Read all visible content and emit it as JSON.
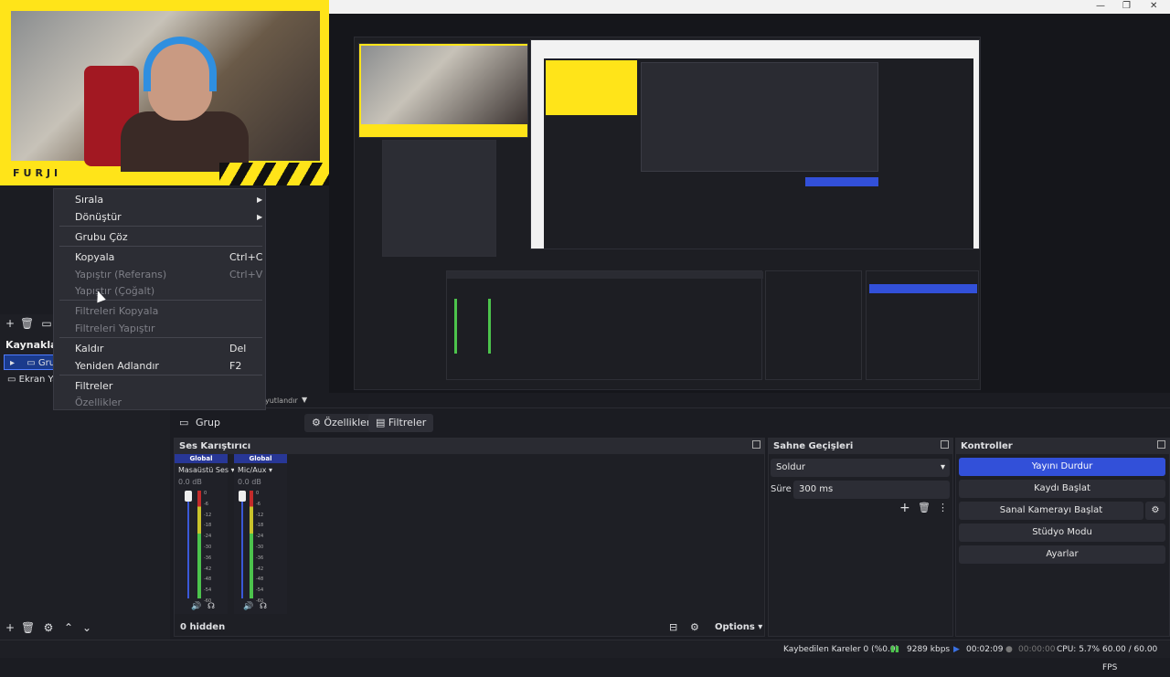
{
  "webcam": {
    "brand": "FURJI"
  },
  "context_menu": {
    "items": [
      {
        "label": "Sırala",
        "shortcut": "",
        "submenu": true,
        "disabled": false
      },
      {
        "label": "Dönüştür",
        "shortcut": "",
        "submenu": true,
        "disabled": false
      },
      {
        "label": "Grubu Çöz",
        "shortcut": "",
        "submenu": false,
        "disabled": false
      },
      {
        "label": "Kopyala",
        "shortcut": "Ctrl+C",
        "submenu": false,
        "disabled": false
      },
      {
        "label": "Yapıştır (Referans)",
        "shortcut": "Ctrl+V",
        "submenu": false,
        "disabled": true
      },
      {
        "label": "Yapıştır (Çoğalt)",
        "shortcut": "",
        "submenu": false,
        "disabled": true
      },
      {
        "label": "Filtreleri Kopyala",
        "shortcut": "",
        "submenu": false,
        "disabled": true
      },
      {
        "label": "Filtreleri Yapıştır",
        "shortcut": "",
        "submenu": false,
        "disabled": true
      },
      {
        "label": "Kaldır",
        "shortcut": "Del",
        "submenu": false,
        "disabled": false
      },
      {
        "label": "Yeniden Adlandır",
        "shortcut": "F2",
        "submenu": false,
        "disabled": false
      },
      {
        "label": "Filtreler",
        "shortcut": "",
        "submenu": false,
        "disabled": false
      },
      {
        "label": "Özellikler",
        "shortcut": "",
        "submenu": false,
        "disabled": true
      }
    ]
  },
  "sources": {
    "title": "Kaynaklar",
    "items": [
      {
        "label": "Grup",
        "selected": true
      },
      {
        "label": "Ekran Yal",
        "selected": false
      }
    ],
    "hint": "yutlandır"
  },
  "source_toolbar": {
    "name": "Grup",
    "properties": "Özellikler",
    "filters": "Filtreler"
  },
  "mixer": {
    "title": "Ses Karıştırıcı",
    "channels": [
      {
        "badge": "Global",
        "name": "Masaüstü Ses",
        "db": "0.0 dB"
      },
      {
        "badge": "Global",
        "name": "Mic/Aux",
        "db": "0.0 dB"
      }
    ],
    "ticks": [
      "0",
      "-6",
      "-12",
      "-18",
      "-24",
      "-30",
      "-36",
      "-42",
      "-48",
      "-54",
      "-60"
    ],
    "hidden": "0 hidden",
    "options": "Options"
  },
  "transitions": {
    "title": "Sahne Geçişleri",
    "selected": "Soldur",
    "duration_label": "Süre",
    "duration": "300 ms"
  },
  "controls": {
    "title": "Kontroller",
    "stop_stream": "Yayını Durdur",
    "start_record": "Kaydı Başlat",
    "virtual_cam": "Sanal Kamerayı Başlat",
    "studio_mode": "Stüdyo Modu",
    "settings": "Ayarlar"
  },
  "status": {
    "dropped": "Kaybedilen Kareler 0 (%0.0)",
    "bitrate": "9289 kbps",
    "stream_time": "00:02:09",
    "record_time": "00:00:00",
    "cpu": "CPU: 5.7%",
    "fps": "60.00 / 60.00 FPS"
  },
  "colors": {
    "accent": "#3250d9",
    "brand_yellow": "#ffe419",
    "bg": "#1b1c22"
  }
}
